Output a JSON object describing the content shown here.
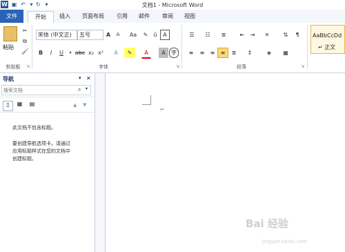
{
  "app": {
    "title": "文档1 - Microsoft Word",
    "logo_letter": "W"
  },
  "quick_access": {
    "save_icon": "save-icon",
    "undo_icon": "undo-icon",
    "redo_icon": "redo-icon",
    "customize_icon": "chevron-down-icon"
  },
  "tabs": [
    {
      "label": "文件"
    },
    {
      "label": "开始"
    },
    {
      "label": "插入"
    },
    {
      "label": "页面布局"
    },
    {
      "label": "引用"
    },
    {
      "label": "邮件"
    },
    {
      "label": "审阅"
    },
    {
      "label": "视图"
    }
  ],
  "ribbon": {
    "clipboard": {
      "paste_label": "粘贴",
      "group_label": "剪贴板"
    },
    "font": {
      "font_name": "宋体 (中文正)",
      "font_size": "五号",
      "grow": "A",
      "shrink": "A",
      "case": "Aa",
      "bold": "B",
      "italic": "I",
      "underline": "U",
      "strike": "abc",
      "sub": "x₂",
      "sup": "x²",
      "color_a": "A",
      "group_label": "字体"
    },
    "paragraph": {
      "group_label": "段落"
    },
    "styles": {
      "sample": "AaBbCcDd",
      "style_name": "↵ 正文"
    }
  },
  "nav_pane": {
    "title": "导航",
    "search_placeholder": "搜索文档",
    "no_headings": "此文档不包含标题。",
    "help_lines": [
      "要创建导航选项卡，请通过",
      "应用标题样式在您的文档中",
      "创建标题。"
    ]
  },
  "watermark": {
    "main": "Bai 经验",
    "sub": "jingyan.baidu.com"
  }
}
